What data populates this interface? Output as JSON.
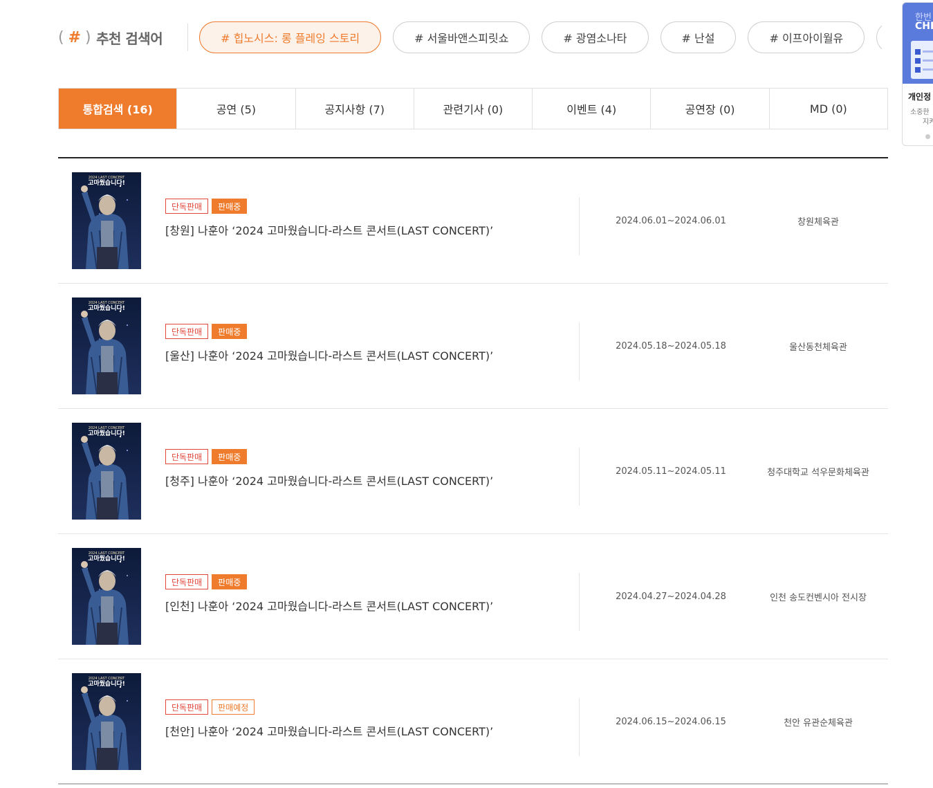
{
  "recommended": {
    "label": "추천 검색어",
    "hash_open": "(",
    "hash_symbol": "#",
    "hash_close": ")",
    "tags": [
      "# 힙노시스: 롱 플레잉 스토리",
      "# 서울바앤스피릿쇼",
      "# 광염소나타",
      "# 난설",
      "# 이프아이월유",
      ""
    ]
  },
  "tabs": [
    "통합검색 (16)",
    "공연 (5)",
    "공지사항 (7)",
    "관련기사 (0)",
    "이벤트 (4)",
    "공연장 (0)",
    "MD (0)"
  ],
  "results": [
    {
      "badges": [
        "단독판매",
        "판매중"
      ],
      "title": "[창원] 나훈아 ‘2024 고마웠습니다-라스트 콘서트(LAST CONCERT)’",
      "period": "2024.06.01~2024.06.01",
      "venue": "창원체육관",
      "poster_text_top": "2024 LAST CONCERT",
      "poster_text_main": "고마웠습니다!"
    },
    {
      "badges": [
        "단독판매",
        "판매중"
      ],
      "title": "[울산] 나훈아 ‘2024 고마웠습니다-라스트 콘서트(LAST CONCERT)’",
      "period": "2024.05.18~2024.05.18",
      "venue": "울산동천체육관",
      "poster_text_top": "2024 LAST CONCERT",
      "poster_text_main": "고마웠습니다!"
    },
    {
      "badges": [
        "단독판매",
        "판매중"
      ],
      "title": "[청주] 나훈아 ‘2024 고마웠습니다-라스트 콘서트(LAST CONCERT)’",
      "period": "2024.05.11~2024.05.11",
      "venue": "청주대학교 석우문화체육관",
      "poster_text_top": "2024 LAST CONCERT",
      "poster_text_main": "고마웠습니다!"
    },
    {
      "badges": [
        "단독판매",
        "판매중"
      ],
      "title": "[인천] 나훈아 ‘2024 고마웠습니다-라스트 콘서트(LAST CONCERT)’",
      "period": "2024.04.27~2024.04.28",
      "venue": "인천 송도컨벤시아 전시장",
      "poster_text_top": "2024 LAST CONCERT",
      "poster_text_main": "고마웠습니다!"
    },
    {
      "badges": [
        "단독판매",
        "판매예정"
      ],
      "title": "[천안] 나훈아 ‘2024 고마웠습니다-라스트 콘서트(LAST CONCERT)’",
      "period": "2024.06.15~2024.06.15",
      "venue": "천안 유관순체육관",
      "poster_text_top": "2024 LAST CONCERT",
      "poster_text_main": "고마웠습니다!"
    }
  ],
  "side_banner": {
    "line1": "한번",
    "line2": "CHE",
    "title": "개인정",
    "desc1": "소중한",
    "desc2": "지켜"
  },
  "colors": {
    "accent": "#ef7b2c",
    "badge_red": "#e2463a"
  }
}
